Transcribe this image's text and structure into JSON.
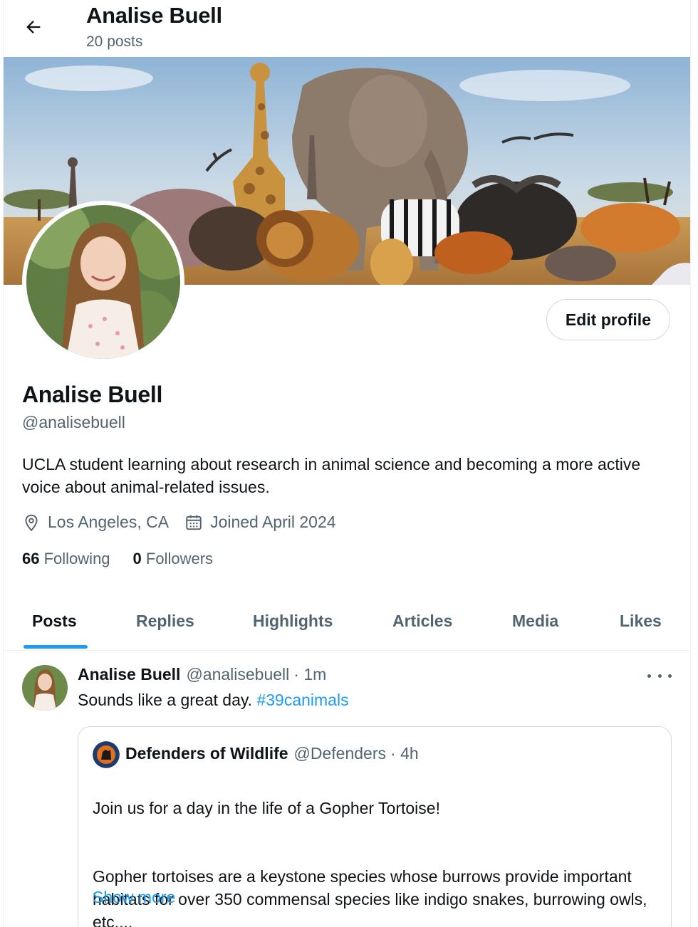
{
  "header": {
    "title": "Analise Buell",
    "post_count": "20 posts"
  },
  "profile": {
    "edit_label": "Edit profile",
    "name": "Analise Buell",
    "handle": "@analisebuell",
    "bio": "UCLA student learning about research in animal science and becoming a more active voice about animal-related issues.",
    "location": "Los Angeles, CA",
    "joined": "Joined April 2024",
    "following_count": "66",
    "following_label": "Following",
    "followers_count": "0",
    "followers_label": "Followers"
  },
  "tabs": [
    {
      "label": "Posts",
      "active": true
    },
    {
      "label": "Replies",
      "active": false
    },
    {
      "label": "Highlights",
      "active": false
    },
    {
      "label": "Articles",
      "active": false
    },
    {
      "label": "Media",
      "active": false
    },
    {
      "label": "Likes",
      "active": false
    }
  ],
  "post": {
    "name": "Analise Buell",
    "handle": "@analisebuell",
    "time": "· 1m",
    "text": "Sounds like a great day.",
    "hashtag": "#39canimals",
    "quote": {
      "name": "Defenders of Wildlife",
      "handle": "@Defenders",
      "time": "· 4h",
      "line1": "Join us for a day in the life of a Gopher Tortoise!",
      "body": "Gopher tortoises are a keystone species whose burrows provide important habitats for over 350 commensal species like indigo snakes, burrowing owls, etc....",
      "show_more": "Show more"
    }
  },
  "colors": {
    "accent": "#1d9bf0",
    "text": "#0f1419",
    "muted": "#536471",
    "border": "#cfd9de"
  },
  "icons": [
    "back-arrow-icon",
    "location-pin-icon",
    "calendar-icon",
    "more-dots-icon"
  ]
}
